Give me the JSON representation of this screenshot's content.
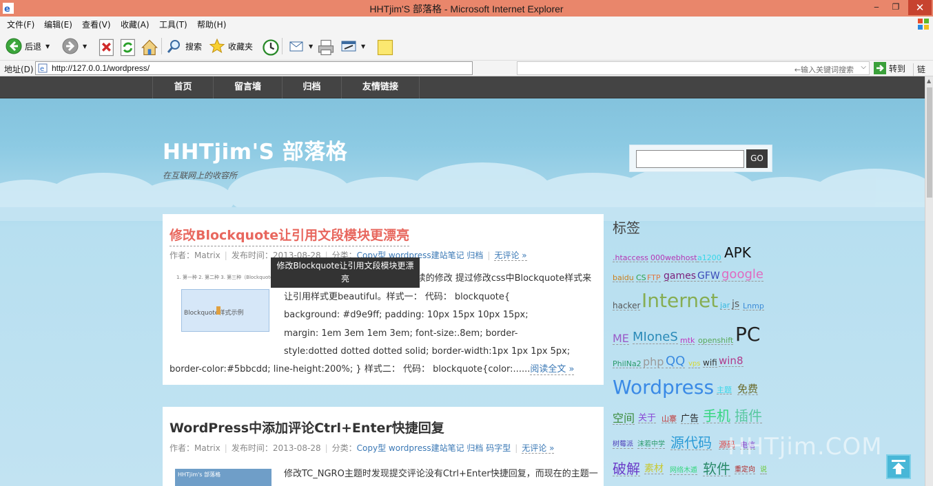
{
  "window": {
    "title": "HHTjim'S 部落格 - Microsoft Internet Explorer",
    "min": "‒",
    "max": "❐",
    "close": "✕"
  },
  "menu": [
    "文件(F)",
    "编辑(E)",
    "查看(V)",
    "收藏(A)",
    "工具(T)",
    "帮助(H)"
  ],
  "toolbar": {
    "back": "后退",
    "search": "搜索",
    "favorites": "收藏夹"
  },
  "address": {
    "label": "地址(D)",
    "url": "http://127.0.0.1/wordpress/",
    "search_placeholder": "←输入关键词搜索",
    "goto": "转到",
    "links": "链接"
  },
  "nav": [
    "首页",
    "留言墙",
    "归档",
    "友情链接"
  ],
  "site": {
    "title": "HHTjim'S 部落格",
    "description": "在互联网上的收容所",
    "search_button": "GO"
  },
  "posts": [
    {
      "title": "修改Blockquote让引用文段模块更漂亮",
      "author": "作者：Matrix",
      "date": "发布时间：2013-08-28",
      "category_label": "分类：",
      "categories": "Copy型 wordpress建站笔记 归档",
      "comments": "无评论 »",
      "thumb_top": "1. 第一种  2. 第二种  3. 第三种（Blockquote样式）  4. 第四种",
      "thumb_text": "Blockquote样式示例",
      "excerpt_lines": [
        "更换主题-七彩   家BLUE2.0以及后续的修改 提过修改css中Blockquote样式来",
        "让引用样式更beautiful。样式一： 代码： blockquote{",
        "background: #d9e9ff;      padding: 10px 15px 10px 15px;",
        "margin: 1em 3em 1em 3em;      font-size:.8em;      border-",
        "style:dotted dotted dotted solid;      border-width:1px 1px 1px 5px;"
      ],
      "excerpt_last": "border-color:#5bbcdd;      line-height:200%;      }      样式二：   代码：  blockquote{color:......",
      "read_more": "阅读全文 »"
    },
    {
      "title": "WordPress中添加评论Ctrl+Enter快捷回复",
      "author": "作者：Matrix",
      "date": "发布时间：2013-08-28",
      "category_label": "分类：",
      "categories": "Copy型 wordpress建站笔记 归档 码字型",
      "comments": "无评论 »",
      "thumb_header": "HHTjim's 部落格",
      "excerpt": "修改TC_NGRO主题时发现提交评论没有Ctrl+Enter快捷回复，而现在的主题一"
    }
  ],
  "tooltip": "修改Blockquote让引用文段模块更漂亮",
  "sidebar": {
    "title": "标签",
    "tags": [
      {
        "text": ".htaccess",
        "color": "#b436b4"
      },
      {
        "text": "000webhost",
        "color": "#b436b4"
      },
      {
        "text": "a1200",
        "color": "#36d6e8"
      },
      {
        "text": "APK",
        "color": "#111111"
      },
      {
        "text": "baidu",
        "color": "#c9801e"
      },
      {
        "text": "CS",
        "color": "#2aa04a"
      },
      {
        "text": "FTP",
        "color": "#e07844"
      },
      {
        "text": "games",
        "color": "#7a1e7a"
      },
      {
        "text": "GFW",
        "color": "#3a4ab8"
      },
      {
        "text": "google",
        "color": "#e06ac0"
      },
      {
        "text": "hacker",
        "color": "#555555"
      },
      {
        "text": "Internet",
        "color": "#86ad52"
      },
      {
        "text": "jar",
        "color": "#36b8e0"
      },
      {
        "text": "js",
        "color": "#5a5a5a"
      },
      {
        "text": "Lnmp",
        "color": "#3a8ad6"
      },
      {
        "text": "ME",
        "color": "#9a5ac8"
      },
      {
        "text": "MIoneS",
        "color": "#2a8ab8"
      },
      {
        "text": "mtk",
        "color": "#c036c0"
      },
      {
        "text": "openshift",
        "color": "#58a858"
      },
      {
        "text": "PC",
        "color": "#222222"
      },
      {
        "text": "PhilNa2",
        "color": "#2a9a6a"
      },
      {
        "text": "php",
        "color": "#9a9a9a"
      },
      {
        "text": "QQ",
        "color": "#3a8ae0"
      },
      {
        "text": "vps",
        "color": "#d8d830"
      },
      {
        "text": "wifi",
        "color": "#333333"
      },
      {
        "text": "win8",
        "color": "#b03a8a"
      },
      {
        "text": "Wordpress",
        "color": "#3a8ae6"
      },
      {
        "text": "主题",
        "color": "#36d6e8"
      },
      {
        "text": "免费",
        "color": "#6a6a2a"
      },
      {
        "text": "空间",
        "color": "#3a8a3a"
      },
      {
        "text": "关于",
        "color": "#8a4ad6"
      },
      {
        "text": "山寨",
        "color": "#c03a3a"
      },
      {
        "text": "广告",
        "color": "#222222"
      },
      {
        "text": "手机",
        "color": "#36d680"
      },
      {
        "text": "插件",
        "color": "#58c8a0"
      },
      {
        "text": "树莓派",
        "color": "#4a3ab8"
      },
      {
        "text": "沫若中学",
        "color": "#2a9a6a"
      },
      {
        "text": "源代码",
        "color": "#2a9ad6"
      },
      {
        "text": "源码",
        "color": "#e04a4a"
      },
      {
        "text": "电信",
        "color": "#8a3ac8"
      },
      {
        "text": "破解",
        "color": "#6a3ac8"
      },
      {
        "text": "素材",
        "color": "#c8c830"
      },
      {
        "text": "网络木遁",
        "color": "#36d680"
      },
      {
        "text": "软件",
        "color": "#2a8a6a"
      },
      {
        "text": "重定向",
        "color": "#b02a2a"
      },
      {
        "text": "说",
        "color": "#6ac836"
      }
    ]
  },
  "watermark": "HHTjim.COM"
}
